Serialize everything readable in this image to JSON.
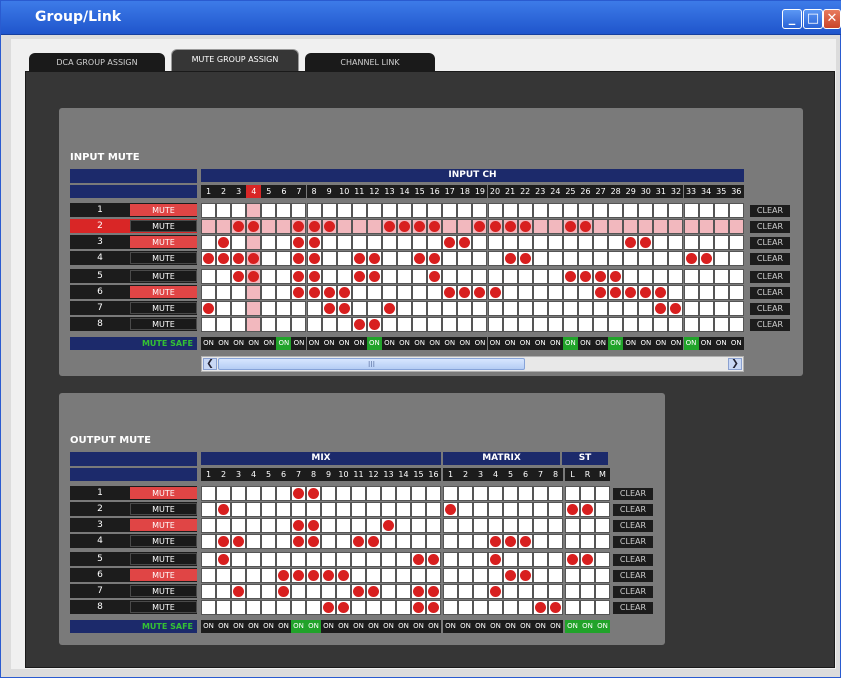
{
  "window": {
    "title": "Group/Link"
  },
  "tabs": [
    {
      "label": "DCA GROUP ASSIGN"
    },
    {
      "label": "MUTE GROUP ASSIGN"
    },
    {
      "label": "CHANNEL LINK"
    }
  ],
  "active_tab": 1,
  "input_mute": {
    "title": "INPUT MUTE",
    "header": "INPUT CH",
    "channels": [
      "1",
      "2",
      "3",
      "4",
      "5",
      "6",
      "7",
      "8",
      "9",
      "10",
      "11",
      "12",
      "13",
      "14",
      "15",
      "16",
      "17",
      "18",
      "19",
      "20",
      "21",
      "22",
      "23",
      "24",
      "25",
      "26",
      "27",
      "28",
      "29",
      "30",
      "31",
      "32",
      "33",
      "34",
      "35",
      "36"
    ],
    "selected_column": 4,
    "rows": [
      {
        "num": "1",
        "mute": "MUTE",
        "mute_on": true,
        "selected": false,
        "assigned": []
      },
      {
        "num": "2",
        "mute": "MUTE",
        "mute_on": false,
        "selected": true,
        "assigned": [
          3,
          4,
          7,
          8,
          9,
          13,
          14,
          15,
          16,
          19,
          20,
          21,
          22,
          25,
          26
        ]
      },
      {
        "num": "3",
        "mute": "MUTE",
        "mute_on": true,
        "selected": false,
        "assigned": [
          2,
          7,
          8,
          17,
          18,
          29,
          30
        ]
      },
      {
        "num": "4",
        "mute": "MUTE",
        "mute_on": false,
        "selected": false,
        "assigned": [
          1,
          2,
          3,
          4,
          7,
          8,
          11,
          12,
          15,
          16,
          21,
          22,
          33,
          34
        ]
      },
      {
        "num": "5",
        "mute": "MUTE",
        "mute_on": false,
        "selected": false,
        "assigned": [
          3,
          4,
          7,
          8,
          11,
          12,
          16,
          25,
          26,
          27,
          28
        ]
      },
      {
        "num": "6",
        "mute": "MUTE",
        "mute_on": true,
        "selected": false,
        "assigned": [
          7,
          8,
          9,
          10,
          17,
          18,
          19,
          20,
          27,
          28,
          29,
          30,
          31
        ]
      },
      {
        "num": "7",
        "mute": "MUTE",
        "mute_on": false,
        "selected": false,
        "assigned": [
          1,
          9,
          10,
          13,
          31,
          32
        ]
      },
      {
        "num": "8",
        "mute": "MUTE",
        "mute_on": false,
        "selected": false,
        "assigned": [
          11,
          12
        ]
      }
    ],
    "clear": "CLEAR",
    "safe_label": "MUTE SAFE",
    "safe_text": "ON",
    "safe_on": [
      6,
      12,
      25,
      28,
      33
    ]
  },
  "output_mute": {
    "title": "OUTPUT MUTE",
    "groups": [
      {
        "label": "MIX"
      },
      {
        "label": "MATRIX"
      },
      {
        "label": "ST"
      }
    ],
    "columns": [
      "1",
      "2",
      "3",
      "4",
      "5",
      "6",
      "7",
      "8",
      "9",
      "10",
      "11",
      "12",
      "13",
      "14",
      "15",
      "16",
      "1",
      "2",
      "3",
      "4",
      "5",
      "6",
      "7",
      "8",
      "L",
      "R",
      "M"
    ],
    "rows": [
      {
        "num": "1",
        "mute": "MUTE",
        "mute_on": true,
        "assigned": [
          7,
          8
        ]
      },
      {
        "num": "2",
        "mute": "MUTE",
        "mute_on": false,
        "assigned": [
          2,
          17,
          25,
          26
        ]
      },
      {
        "num": "3",
        "mute": "MUTE",
        "mute_on": true,
        "assigned": [
          7,
          8,
          13
        ]
      },
      {
        "num": "4",
        "mute": "MUTE",
        "mute_on": false,
        "assigned": [
          2,
          3,
          7,
          8,
          11,
          12,
          20,
          21,
          22
        ]
      },
      {
        "num": "5",
        "mute": "MUTE",
        "mute_on": false,
        "assigned": [
          2,
          15,
          16,
          20,
          25,
          26
        ]
      },
      {
        "num": "6",
        "mute": "MUTE",
        "mute_on": true,
        "assigned": [
          6,
          7,
          8,
          9,
          10,
          21,
          22
        ]
      },
      {
        "num": "7",
        "mute": "MUTE",
        "mute_on": false,
        "assigned": [
          3,
          6,
          11,
          12,
          15,
          16,
          20
        ]
      },
      {
        "num": "8",
        "mute": "MUTE",
        "mute_on": false,
        "assigned": [
          9,
          10,
          15,
          16,
          23,
          24
        ]
      }
    ],
    "clear": "CLEAR",
    "safe_label": "MUTE SAFE",
    "safe_text": "ON",
    "safe_on": [
      7,
      8,
      25,
      26,
      27
    ]
  },
  "scrollbar": {
    "thumb_label": "III",
    "thumb_fraction": 0.6
  }
}
